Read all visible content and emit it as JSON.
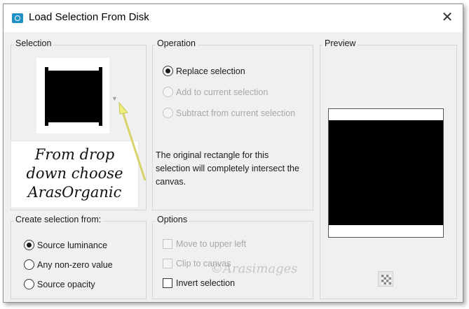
{
  "window": {
    "title": "Load Selection From Disk",
    "close_glyph": "✕",
    "icon": "app-icon"
  },
  "selection": {
    "label": "Selection",
    "thumbnail": "selection-shape-thumbnail",
    "dropdown_glyph": "▼"
  },
  "annotation": {
    "lines": [
      "From drop",
      "down choose",
      "ArasOrganic"
    ],
    "arrow_color": "#f0f07a"
  },
  "operation": {
    "label": "Operation",
    "options": [
      {
        "label": "Replace selection",
        "checked": true,
        "enabled": true
      },
      {
        "label": "Add to current selection",
        "checked": false,
        "enabled": false
      },
      {
        "label": "Subtract from current selection",
        "checked": false,
        "enabled": false
      }
    ],
    "description": "The original rectangle for this selection will completely intersect the canvas."
  },
  "preview": {
    "label": "Preview",
    "checker_icon": "checkerboard-icon"
  },
  "create_from": {
    "label": "Create selection from:",
    "options": [
      {
        "label": "Source luminance",
        "checked": true
      },
      {
        "label": "Any non-zero value",
        "checked": false
      },
      {
        "label": "Source opacity",
        "checked": false
      }
    ]
  },
  "options": {
    "label": "Options",
    "items": [
      {
        "label": "Move to upper left",
        "checked": false,
        "enabled": false
      },
      {
        "label": "Clip to canvas",
        "checked": false,
        "enabled": false
      },
      {
        "label": "Invert selection",
        "checked": false,
        "enabled": true
      }
    ]
  },
  "watermark": "©Arasimages"
}
